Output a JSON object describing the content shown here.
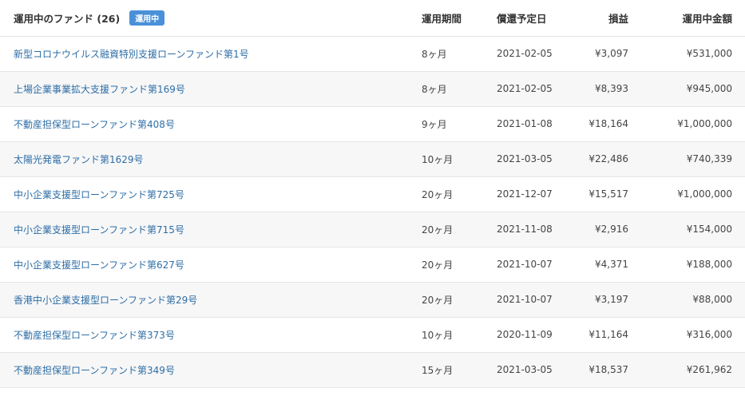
{
  "header": {
    "title": "運用中のファンド (26)",
    "badge": "運用中",
    "columns": {
      "period": "運用期間",
      "redemption_date": "償還予定日",
      "profit": "損益",
      "amount": "運用中金額"
    }
  },
  "rows": [
    {
      "name": "新型コロナウイルス融資特別支援ローンファンド第1号",
      "period": "8ヶ月",
      "date": "2021-02-05",
      "profit": "¥3,097",
      "amount": "¥531,000"
    },
    {
      "name": "上場企業事業拡大支援ファンド第169号",
      "period": "8ヶ月",
      "date": "2021-02-05",
      "profit": "¥8,393",
      "amount": "¥945,000"
    },
    {
      "name": "不動産担保型ローンファンド第408号",
      "period": "9ヶ月",
      "date": "2021-01-08",
      "profit": "¥18,164",
      "amount": "¥1,000,000"
    },
    {
      "name": "太陽光発電ファンド第1629号",
      "period": "10ヶ月",
      "date": "2021-03-05",
      "profit": "¥22,486",
      "amount": "¥740,339"
    },
    {
      "name": "中小企業支援型ローンファンド第725号",
      "period": "20ヶ月",
      "date": "2021-12-07",
      "profit": "¥15,517",
      "amount": "¥1,000,000"
    },
    {
      "name": "中小企業支援型ローンファンド第715号",
      "period": "20ヶ月",
      "date": "2021-11-08",
      "profit": "¥2,916",
      "amount": "¥154,000"
    },
    {
      "name": "中小企業支援型ローンファンド第627号",
      "period": "20ヶ月",
      "date": "2021-10-07",
      "profit": "¥4,371",
      "amount": "¥188,000"
    },
    {
      "name": "香港中小企業支援型ローンファンド第29号",
      "period": "20ヶ月",
      "date": "2021-10-07",
      "profit": "¥3,197",
      "amount": "¥88,000"
    },
    {
      "name": "不動産担保型ローンファンド第373号",
      "period": "10ヶ月",
      "date": "2020-11-09",
      "profit": "¥11,164",
      "amount": "¥316,000"
    },
    {
      "name": "不動産担保型ローンファンド第349号",
      "period": "15ヶ月",
      "date": "2021-03-05",
      "profit": "¥18,537",
      "amount": "¥261,962"
    }
  ],
  "colors": {
    "link": "#2e6ea6",
    "badge_bg": "#4a90d9",
    "row_alt": "#f7f7f7",
    "border": "#e6e6e6"
  }
}
